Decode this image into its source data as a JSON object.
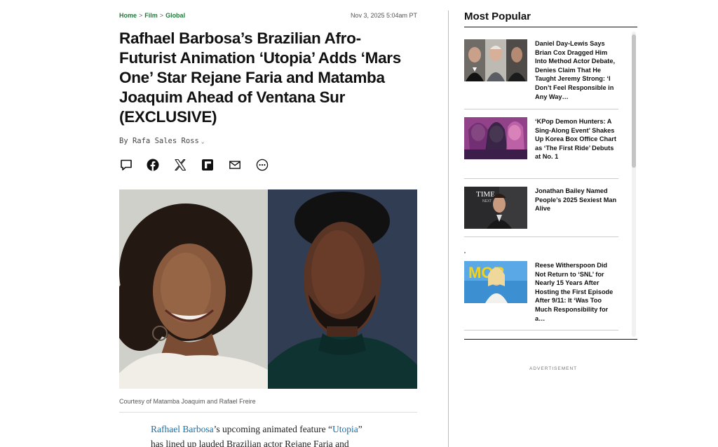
{
  "breadcrumb": {
    "home": "Home",
    "sep1": ">",
    "film": "Film",
    "sep2": ">",
    "global": "Global"
  },
  "dateline": "Nov 3, 2025 5:04am PT",
  "headline": "Rafhael Barbosa’s Brazilian Afro-Futurist Animation ‘Utopia’ Adds ‘Mars One’ Star Rejane Faria and Matamba Joaquim Ahead of Ventana Sur (EXCLUSIVE)",
  "byline": {
    "author": "By Rafa Sales Ross",
    "chevron": "⌄"
  },
  "share": {
    "icons": [
      "comment-icon",
      "facebook-icon",
      "x-icon",
      "flipboard-icon",
      "email-icon",
      "more-icon"
    ]
  },
  "hero": {
    "caption": "Courtesy of Matamba Joaquim and Rafael Freire"
  },
  "body": {
    "link1": "Rafhael Barbosa",
    "text1": "’s upcoming animated feature “",
    "link2": "Utopia",
    "text2": "”",
    "line2": "has lined up lauded Brazilian actor Rejane Faria and"
  },
  "most_popular": {
    "title": "Most Popular",
    "items": [
      {
        "headline": "Daniel Day-Lewis Says Brian Cox Dragged Him Into Method Actor Debate, Denies Claim That He Taught Jeremy Strong: ‘I Don’t Feel Responsible in Any Way…"
      },
      {
        "headline": "‘KPop Demon Hunters: A Sing-Along Event’ Shakes Up Korea Box Office Chart as ‘The First Ride’ Debuts at No. 1"
      },
      {
        "headline": "Jonathan Bailey Named People’s 2025 Sexiest Man Alive"
      },
      {
        "headline": "Reese Witherspoon Did Not Return to ‘SNL’ for Nearly 15 Years After Hosting the First Episode After 9/11: It ‘Was Too Much Responsibility for a…"
      }
    ],
    "thumb_text": {
      "time": "TIME",
      "next": "NEXT",
      "mor": "MOR"
    }
  },
  "ad_label": "ADVERTISEMENT",
  "colors": {
    "breadcrumb": "#1f7a3a",
    "link": "#1a6fa8",
    "text": "#111111"
  }
}
